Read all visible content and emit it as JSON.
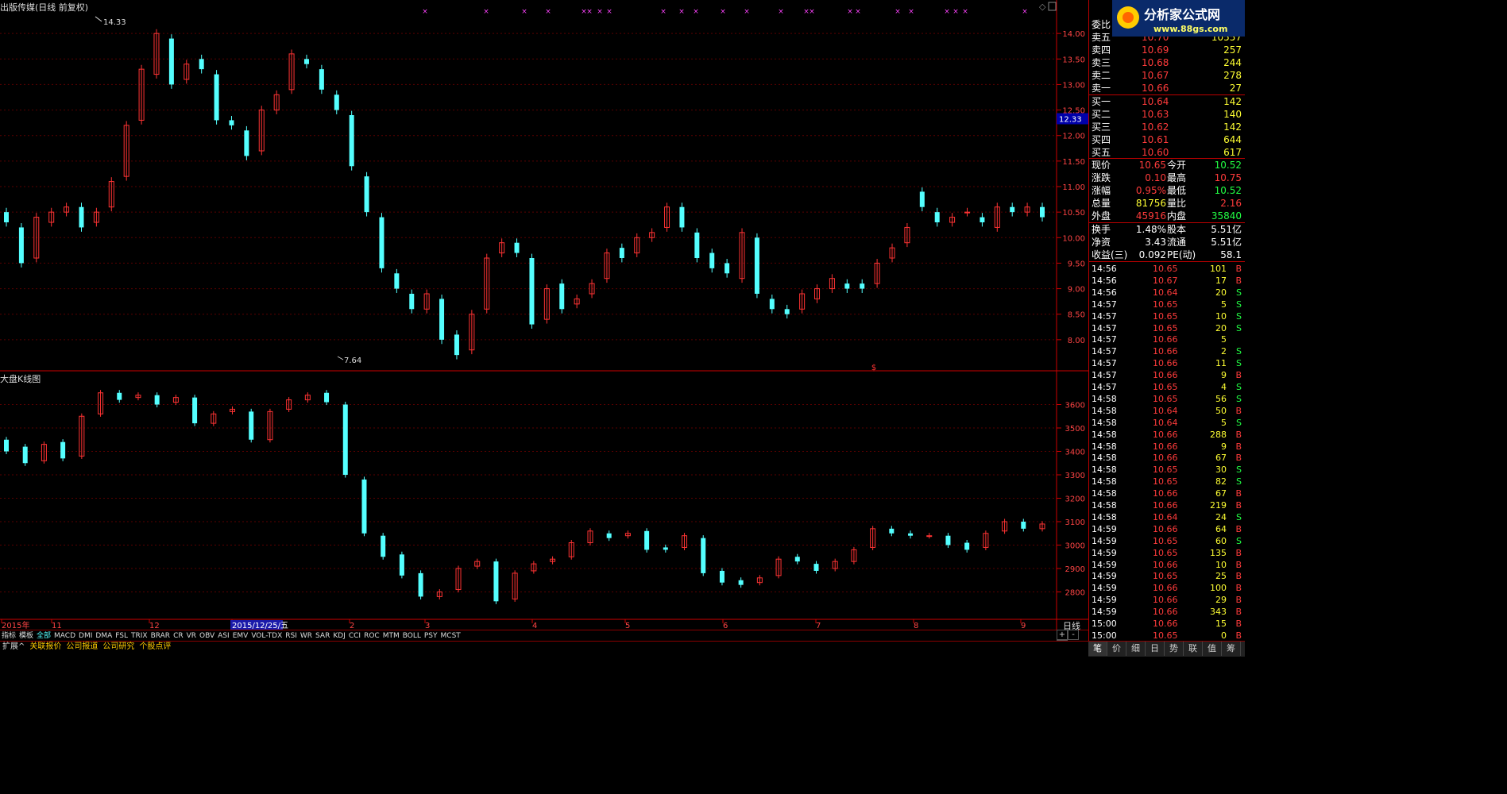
{
  "stock_title": "出版传媒(日线 前复权)",
  "index_title": "大盘K线图",
  "price_axis": [
    "14.00",
    "13.50",
    "13.00",
    "12.50",
    "12.00",
    "11.50",
    "11.00",
    "10.50",
    "10.00",
    "9.50",
    "9.00",
    "8.50",
    "8.00"
  ],
  "price_marker": "12.33",
  "high_label": "14.33",
  "low_label": "7.64",
  "index_axis": [
    "3600",
    "3500",
    "3400",
    "3300",
    "3200",
    "3100",
    "3000",
    "2900",
    "2800"
  ],
  "dollar_marker": "$",
  "date_axis": [
    "2015年",
    "11",
    "12",
    "2015/12/25/五",
    "2",
    "3",
    "4",
    "5",
    "6",
    "7",
    "8",
    "9"
  ],
  "period_label": "日线",
  "indicator_tabs": [
    "指标",
    "模板",
    "全部",
    "MACD",
    "DMI",
    "DMA",
    "FSL",
    "TRIX",
    "BRAR",
    "CR",
    "VR",
    "OBV",
    "ASI",
    "EMV",
    "VOL-TDX",
    "RSI",
    "WR",
    "SAR",
    "KDJ",
    "CCI",
    "ROC",
    "MTM",
    "BOLL",
    "PSY",
    "MCST"
  ],
  "bottom_tabs": [
    "扩展^",
    "关联报价",
    "公司报道",
    "公司研究",
    "个股点评"
  ],
  "zoom": [
    "+",
    "-",
    "○"
  ],
  "logo": {
    "text": "分析家公式网",
    "url_text": "www.88gs.com"
  },
  "order_book": {
    "wei_bi_label": "委比",
    "sell": [
      {
        "label": "卖五",
        "price": "10.70",
        "vol": "10557"
      },
      {
        "label": "卖四",
        "price": "10.69",
        "vol": "257"
      },
      {
        "label": "卖三",
        "price": "10.68",
        "vol": "244"
      },
      {
        "label": "卖二",
        "price": "10.67",
        "vol": "278"
      },
      {
        "label": "卖一",
        "price": "10.66",
        "vol": "27"
      }
    ],
    "buy": [
      {
        "label": "买一",
        "price": "10.64",
        "vol": "142"
      },
      {
        "label": "买二",
        "price": "10.63",
        "vol": "140"
      },
      {
        "label": "买三",
        "price": "10.62",
        "vol": "142"
      },
      {
        "label": "买四",
        "price": "10.61",
        "vol": "644"
      },
      {
        "label": "买五",
        "price": "10.60",
        "vol": "617"
      }
    ]
  },
  "quote": [
    {
      "l1": "现价",
      "v1": "10.65",
      "l2": "今开",
      "v2": "10.52",
      "c1": "red",
      "c2": "green"
    },
    {
      "l1": "涨跌",
      "v1": "0.10",
      "l2": "最高",
      "v2": "10.75",
      "c1": "red",
      "c2": "red"
    },
    {
      "l1": "涨幅",
      "v1": "0.95%",
      "l2": "最低",
      "v2": "10.52",
      "c1": "red",
      "c2": "green"
    },
    {
      "l1": "总量",
      "v1": "81756",
      "l2": "量比",
      "v2": "2.16",
      "c1": "yellow",
      "c2": "red"
    },
    {
      "l1": "外盘",
      "v1": "45916",
      "l2": "内盘",
      "v2": "35840",
      "c1": "red",
      "c2": "green"
    }
  ],
  "fundamentals": [
    {
      "l1": "换手",
      "v1": "1.48%",
      "l2": "股本",
      "v2": "5.51亿"
    },
    {
      "l1": "净资",
      "v1": "3.43",
      "l2": "流通",
      "v2": "5.51亿"
    },
    {
      "l1": "收益(三)",
      "v1": "0.092",
      "l2": "PE(动)",
      "v2": "58.1"
    }
  ],
  "ticks": [
    {
      "t": "14:56",
      "p": "10.65",
      "v": "101",
      "d": "B"
    },
    {
      "t": "14:56",
      "p": "10.67",
      "v": "17",
      "d": "B"
    },
    {
      "t": "14:56",
      "p": "10.64",
      "v": "20",
      "d": "S"
    },
    {
      "t": "14:57",
      "p": "10.65",
      "v": "5",
      "d": "S"
    },
    {
      "t": "14:57",
      "p": "10.65",
      "v": "10",
      "d": "S"
    },
    {
      "t": "14:57",
      "p": "10.65",
      "v": "20",
      "d": "S"
    },
    {
      "t": "14:57",
      "p": "10.66",
      "v": "5",
      "d": ""
    },
    {
      "t": "14:57",
      "p": "10.66",
      "v": "2",
      "d": "S"
    },
    {
      "t": "14:57",
      "p": "10.66",
      "v": "11",
      "d": "S"
    },
    {
      "t": "14:57",
      "p": "10.66",
      "v": "9",
      "d": "B"
    },
    {
      "t": "14:57",
      "p": "10.65",
      "v": "4",
      "d": "S"
    },
    {
      "t": "14:58",
      "p": "10.65",
      "v": "56",
      "d": "S"
    },
    {
      "t": "14:58",
      "p": "10.64",
      "v": "50",
      "d": "B"
    },
    {
      "t": "14:58",
      "p": "10.64",
      "v": "5",
      "d": "S"
    },
    {
      "t": "14:58",
      "p": "10.66",
      "v": "288",
      "d": "B"
    },
    {
      "t": "14:58",
      "p": "10.66",
      "v": "9",
      "d": "B"
    },
    {
      "t": "14:58",
      "p": "10.66",
      "v": "67",
      "d": "B"
    },
    {
      "t": "14:58",
      "p": "10.65",
      "v": "30",
      "d": "S"
    },
    {
      "t": "14:58",
      "p": "10.65",
      "v": "82",
      "d": "S"
    },
    {
      "t": "14:58",
      "p": "10.66",
      "v": "67",
      "d": "B"
    },
    {
      "t": "14:58",
      "p": "10.66",
      "v": "219",
      "d": "B"
    },
    {
      "t": "14:58",
      "p": "10.64",
      "v": "24",
      "d": "S"
    },
    {
      "t": "14:59",
      "p": "10.66",
      "v": "64",
      "d": "B"
    },
    {
      "t": "14:59",
      "p": "10.65",
      "v": "60",
      "d": "S"
    },
    {
      "t": "14:59",
      "p": "10.65",
      "v": "135",
      "d": "B"
    },
    {
      "t": "14:59",
      "p": "10.66",
      "v": "10",
      "d": "B"
    },
    {
      "t": "14:59",
      "p": "10.65",
      "v": "25",
      "d": "B"
    },
    {
      "t": "14:59",
      "p": "10.66",
      "v": "100",
      "d": "B"
    },
    {
      "t": "14:59",
      "p": "10.66",
      "v": "29",
      "d": "B"
    },
    {
      "t": "14:59",
      "p": "10.66",
      "v": "343",
      "d": "B"
    },
    {
      "t": "15:00",
      "p": "10.66",
      "v": "15",
      "d": "B"
    },
    {
      "t": "15:00",
      "p": "10.65",
      "v": "0",
      "d": "B"
    }
  ],
  "panel_tabs": [
    "笔",
    "价",
    "细",
    "日",
    "势",
    "联",
    "值",
    "筹"
  ],
  "colors": {
    "up": "#ff3333",
    "down": "#54ffff",
    "grid": "#8b0000",
    "axis": "#cc0000",
    "marker_bg": "#0000aa"
  },
  "chart_data": [
    {
      "type": "candlestick",
      "title": "出版传媒(日线 前复权)",
      "ylim": [
        7.5,
        14.5
      ],
      "annotations": {
        "high": 14.33,
        "low": 7.64,
        "marker": 12.33
      },
      "closes": [
        10.3,
        9.5,
        10.4,
        10.5,
        10.6,
        10.2,
        10.5,
        11.1,
        12.2,
        13.3,
        14.0,
        13.0,
        13.4,
        13.3,
        12.3,
        12.2,
        11.6,
        12.5,
        12.8,
        13.6,
        13.4,
        12.9,
        12.5,
        11.4,
        10.5,
        9.4,
        9.0,
        8.6,
        8.9,
        8.0,
        7.7,
        8.5,
        9.6,
        9.9,
        9.7,
        8.3,
        9.0,
        8.6,
        8.8,
        9.1,
        9.7,
        9.6,
        10.0,
        10.1,
        10.6,
        10.2,
        9.6,
        9.4,
        9.3,
        10.1,
        8.9,
        8.6,
        8.5,
        8.9,
        9.0,
        9.2,
        9.0,
        9.0,
        9.5,
        9.8,
        10.2,
        10.6,
        10.3,
        10.4,
        10.5,
        10.3,
        10.6,
        10.5,
        10.6,
        10.4
      ],
      "opens": [
        10.5,
        10.2,
        9.6,
        10.3,
        10.5,
        10.6,
        10.3,
        10.6,
        11.2,
        12.3,
        13.2,
        13.9,
        13.1,
        13.5,
        13.2,
        12.3,
        12.1,
        11.7,
        12.5,
        12.9,
        13.5,
        13.3,
        12.8,
        12.4,
        11.2,
        10.4,
        9.3,
        8.9,
        8.6,
        8.8,
        8.1,
        7.8,
        8.6,
        9.7,
        9.9,
        9.6,
        8.4,
        9.1,
        8.7,
        8.9,
        9.2,
        9.8,
        9.7,
        10.0,
        10.2,
        10.6,
        10.1,
        9.7,
        9.5,
        9.2,
        10.0,
        8.8,
        8.6,
        8.6,
        8.8,
        9.0,
        9.1,
        9.1,
        9.1,
        9.6,
        9.9,
        10.9,
        10.5,
        10.3,
        10.5,
        10.4,
        10.2,
        10.6,
        10.5,
        10.6
      ]
    },
    {
      "type": "candlestick",
      "title": "大盘K线图",
      "ylim": [
        2700,
        3700
      ],
      "closes": [
        3400,
        3350,
        3430,
        3370,
        3550,
        3650,
        3620,
        3640,
        3600,
        3630,
        3520,
        3560,
        3580,
        3450,
        3570,
        3620,
        3640,
        3610,
        3300,
        3050,
        2950,
        2870,
        2780,
        2800,
        2900,
        2930,
        2760,
        2880,
        2920,
        2940,
        3010,
        3060,
        3030,
        3050,
        2980,
        2980,
        3040,
        2880,
        2840,
        2830,
        2860,
        2940,
        2930,
        2890,
        2930,
        2980,
        3070,
        3050,
        3040,
        3040,
        3000,
        2980,
        3050,
        3100,
        3070,
        3090
      ],
      "opens": [
        3450,
        3420,
        3360,
        3440,
        3380,
        3560,
        3650,
        3630,
        3640,
        3610,
        3630,
        3520,
        3570,
        3570,
        3450,
        3580,
        3620,
        3650,
        3600,
        3280,
        3040,
        2960,
        2880,
        2780,
        2810,
        2910,
        2930,
        2770,
        2890,
        2930,
        2950,
        3010,
        3050,
        3040,
        3060,
        2990,
        2990,
        3030,
        2890,
        2850,
        2840,
        2870,
        2950,
        2920,
        2900,
        2930,
        2990,
        3070,
        3050,
        3040,
        3040,
        3010,
        2990,
        3060,
        3100,
        3070
      ]
    }
  ]
}
